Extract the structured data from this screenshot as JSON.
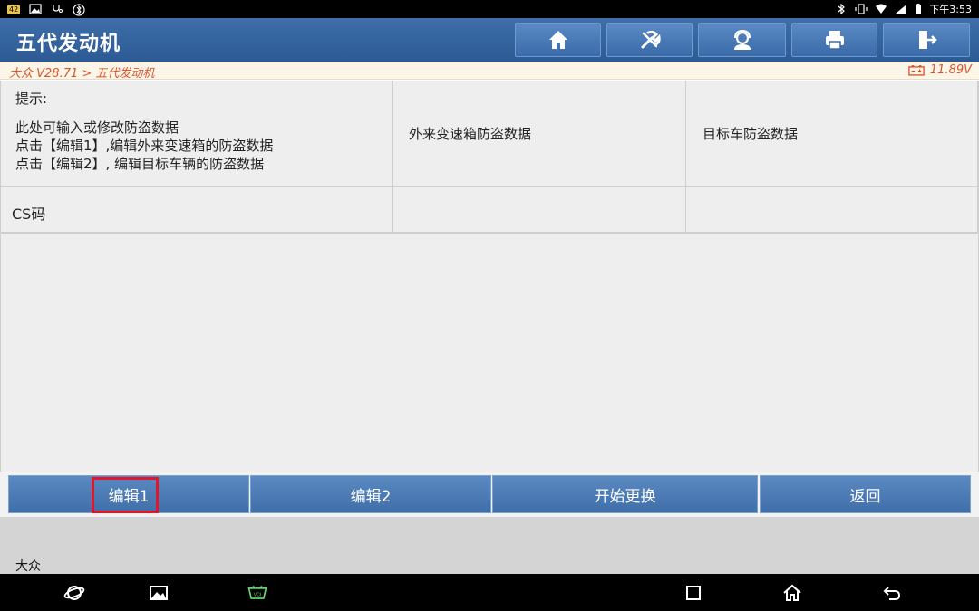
{
  "status_bar": {
    "badge": "42",
    "time": "下午3:53"
  },
  "header": {
    "title": "五代发动机",
    "buttons": [
      {
        "name": "home-icon"
      },
      {
        "name": "diagnose-tools-icon"
      },
      {
        "name": "support-agent-icon"
      },
      {
        "name": "printer-icon"
      },
      {
        "name": "exit-icon"
      }
    ]
  },
  "breadcrumb": {
    "path": "大众 V28.71 > 五代发动机",
    "voltage": "11.89V"
  },
  "table": {
    "hint": {
      "title": "提示:",
      "lines": [
        "此处可输入或修改防盗数据",
        "点击【编辑1】,编辑外来变速箱的防盗数据",
        "点击【编辑2】, 编辑目标车辆的防盗数据"
      ]
    },
    "columns": [
      "外来变速箱防盗数据",
      "目标车防盗数据"
    ],
    "rows": [
      {
        "label": "CS码",
        "values": [
          "",
          ""
        ]
      }
    ]
  },
  "actions": {
    "edit1": "编辑1",
    "edit2": "编辑2",
    "start": "开始更换",
    "back": "返回"
  },
  "footer": {
    "brand": "大众"
  },
  "colors": {
    "header_blue": "#2c5a94",
    "button_blue": "#4a7ab6",
    "breadcrumb_text": "#d9532b",
    "highlight_red": "#e0162b"
  }
}
